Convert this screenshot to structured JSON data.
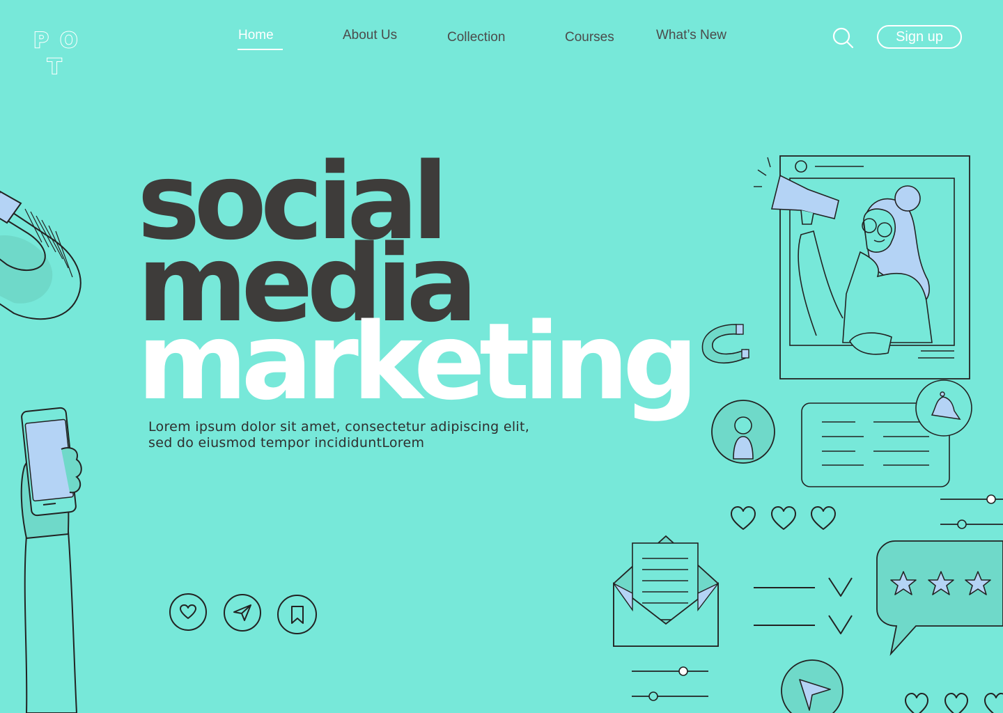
{
  "logo": {
    "letters": [
      "P",
      "O",
      "T"
    ]
  },
  "nav": {
    "items": [
      {
        "label": "Home",
        "active": true
      },
      {
        "label": "About Us",
        "active": false
      },
      {
        "label": "Collection",
        "active": false
      },
      {
        "label": "Courses",
        "active": false
      },
      {
        "label": "What’s New",
        "active": false
      }
    ],
    "search_icon": "search-icon",
    "signup_label": "Sign up"
  },
  "hero": {
    "line1": "social",
    "line2": "media",
    "line3": "marketing",
    "description_line1": "Lorem ipsum dolor sit amet, consectetur adipiscing elit,",
    "description_line2": "sed do eiusmod tempor incididuntLorem"
  },
  "actions": {
    "like_icon": "heart-icon",
    "share_icon": "paper-plane-icon",
    "bookmark_icon": "bookmark-icon"
  },
  "colors": {
    "background": "#77e8d9",
    "dark_text": "#3e3c3a",
    "white": "#ffffff",
    "accent_blue": "#b4d3f5",
    "outline": "#222222"
  }
}
